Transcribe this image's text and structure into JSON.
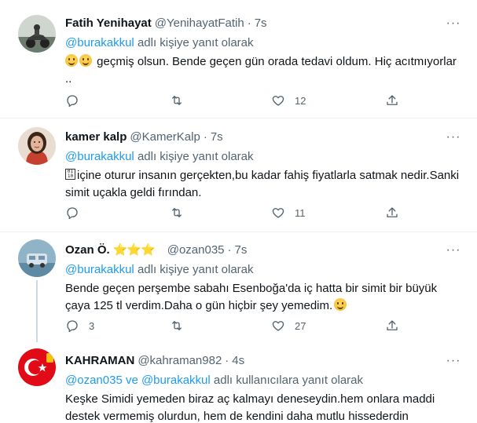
{
  "tweets": [
    {
      "name": "Fatih Yenihayat",
      "handle": "@YenihayatFatih",
      "dot": "·",
      "time": "7s",
      "reply_prefix": "@burakakkul",
      "reply_suffix": " adlı kişiye yanıt olarak",
      "text": "geçmiş olsun. Bende geçen gün orada tedavi oldum. Hiç acıtmıyorlar ..",
      "emoji": [
        "grinning-face",
        "grinning-face"
      ],
      "replies": "",
      "retweets": "",
      "likes": "12"
    },
    {
      "name": "kamer kalp",
      "handle": "@KamerKalp",
      "dot": "·",
      "time": "7s",
      "reply_prefix": "@burakakkul",
      "reply_suffix": " adlı kişiye yanıt olarak",
      "text": "içine oturur insanın gerçekten,bu kadar fahiş fiyatlarla satmak nedir.Sanki simit uçakla geldi fırından.",
      "emoji": [
        "unknown-glyph"
      ],
      "replies": "",
      "retweets": "",
      "likes": "11"
    },
    {
      "name": "Ozan Ö.",
      "stars": "⭐⭐⭐",
      "handle": "@ozan035",
      "dot": "·",
      "time": "7s",
      "reply_prefix": "@burakakkul",
      "reply_suffix": " adlı kişiye yanıt olarak",
      "text": "Bende geçen perşembe sabahı Esenboğa'da iç hatta bir simit bir büyük çaya 125 tl verdim.Daha o gün hiçbir şey yemedim.",
      "emoji": [
        "grinning-face"
      ],
      "replies": "3",
      "retweets": "",
      "likes": "27"
    },
    {
      "name": "KAHRAMAN",
      "handle": "@kahraman982",
      "dot": "·",
      "time": "4s",
      "reply_prefix": "@ozan035 ve @burakakkul",
      "reply_suffix": " adlı kullanıcılara yanıt olarak",
      "text": "Keşke Simidi yemeden biraz aç kalmayı deneseydin.hem onlara maddi destek vermemiş olurdun, hem de kendini daha mutlu hissederdin"
    }
  ],
  "more_glyph": "···",
  "glyph_text": "01\n10",
  "icons": {
    "reply": "reply-icon",
    "retweet": "retweet-icon",
    "like": "like-icon",
    "share": "share-icon",
    "more": "more-icon"
  },
  "colors": {
    "accent": "#1d9bf0",
    "secondary_text": "#536471",
    "divider": "#eff3f4",
    "thread_line": "#cfd9de"
  }
}
